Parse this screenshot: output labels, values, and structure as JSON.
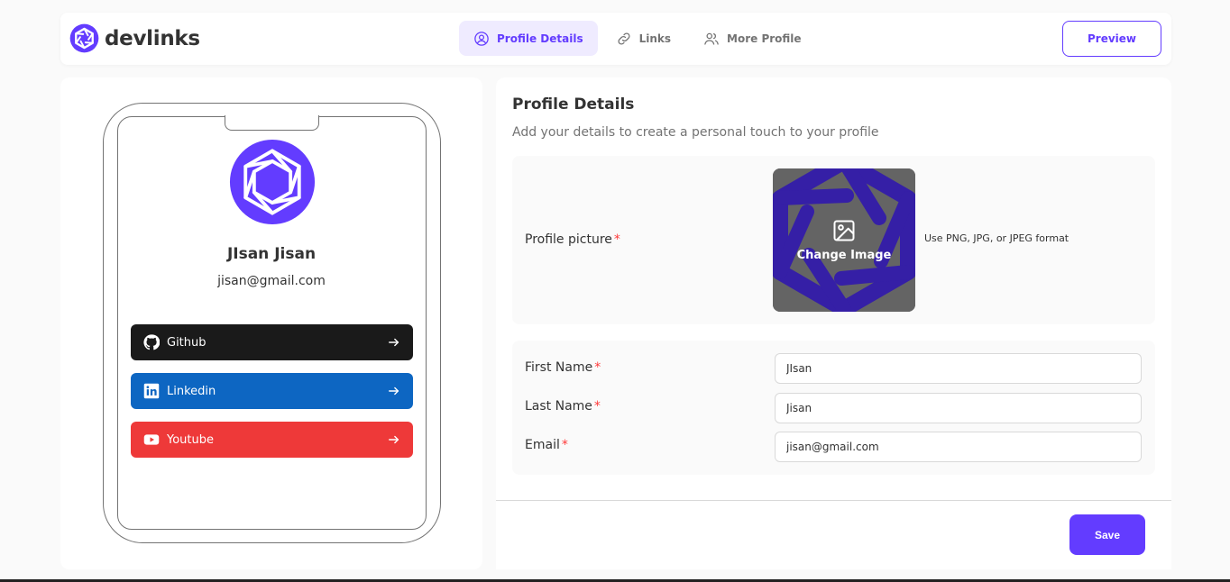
{
  "app": {
    "name": "devlinks",
    "accent_color": "#633cff"
  },
  "nav": {
    "tabs": [
      {
        "label": "Profile Details",
        "icon": "user-circle-icon",
        "active": true
      },
      {
        "label": "Links",
        "icon": "link-icon",
        "active": false
      },
      {
        "label": "More Profile",
        "icon": "users-icon",
        "active": false
      }
    ],
    "preview_label": "Preview"
  },
  "preview": {
    "name": "JIsan Jisan",
    "email": "jisan@gmail.com",
    "links": [
      {
        "label": "Github",
        "icon": "github-icon",
        "color": "#1a1a1a"
      },
      {
        "label": "Linkedin",
        "icon": "linkedin-icon",
        "color": "#0d66c2"
      },
      {
        "label": "Youtube",
        "icon": "youtube-icon",
        "color": "#ee3939"
      }
    ]
  },
  "profile_form": {
    "title": "Profile Details",
    "subtitle": "Add your details to create a personal touch to your profile",
    "picture_label": "Profile picture",
    "required_mark": "*",
    "change_image_label": "Change Image",
    "picture_hint": "Use PNG, JPG, or JPEG format",
    "fields": [
      {
        "label": "First Name",
        "value": "JIsan"
      },
      {
        "label": "Last Name",
        "value": "Jisan"
      },
      {
        "label": "Email",
        "value": "jisan@gmail.com"
      }
    ],
    "save_label": "Save"
  }
}
